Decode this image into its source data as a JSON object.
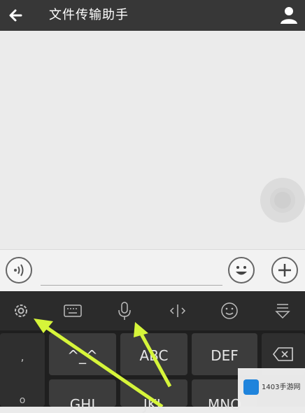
{
  "header": {
    "title": "文件传输助手"
  },
  "keyboard": {
    "keys": {
      "comma": ",",
      "symbols": "^_^",
      "abc": "ABC",
      "def": "DEF",
      "ghi": "GHI",
      "jkl": "JKL",
      "mno": "MNO"
    }
  },
  "watermark": {
    "text": "1403手游网"
  },
  "colors": {
    "header": "#373737",
    "arrow": "#d6f53a",
    "keyboard": "#1f1f1f"
  }
}
